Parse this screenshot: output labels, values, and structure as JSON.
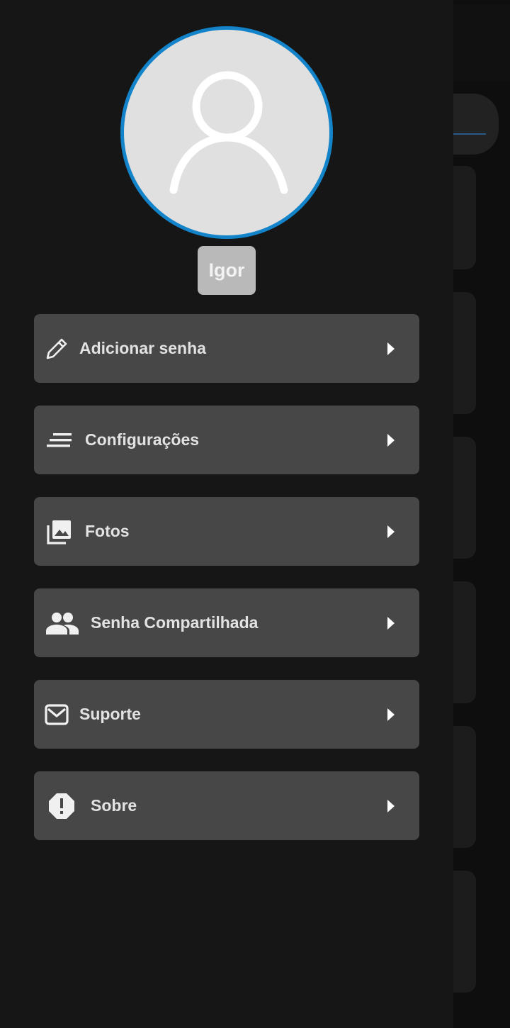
{
  "drawer": {
    "profile": {
      "avatar_icon": "person-outline-icon",
      "name": "Igor",
      "accent_color": "#1384c9"
    },
    "menu": [
      {
        "label": "Adicionar senha",
        "icon": "pencil-icon"
      },
      {
        "label": "Configurações",
        "icon": "settings-lines-icon"
      },
      {
        "label": "Fotos",
        "icon": "photo-library-icon"
      },
      {
        "label": "Senha Compartilhada",
        "icon": "people-icon"
      },
      {
        "label": "Suporte",
        "icon": "mail-icon"
      },
      {
        "label": "Sobre",
        "icon": "alert-octagon-icon"
      }
    ],
    "arrow_icon": "chevron-right-icon"
  },
  "colors": {
    "drawer_bg": "#161617",
    "item_bg": "#484747",
    "text": "#e2e2e2"
  }
}
